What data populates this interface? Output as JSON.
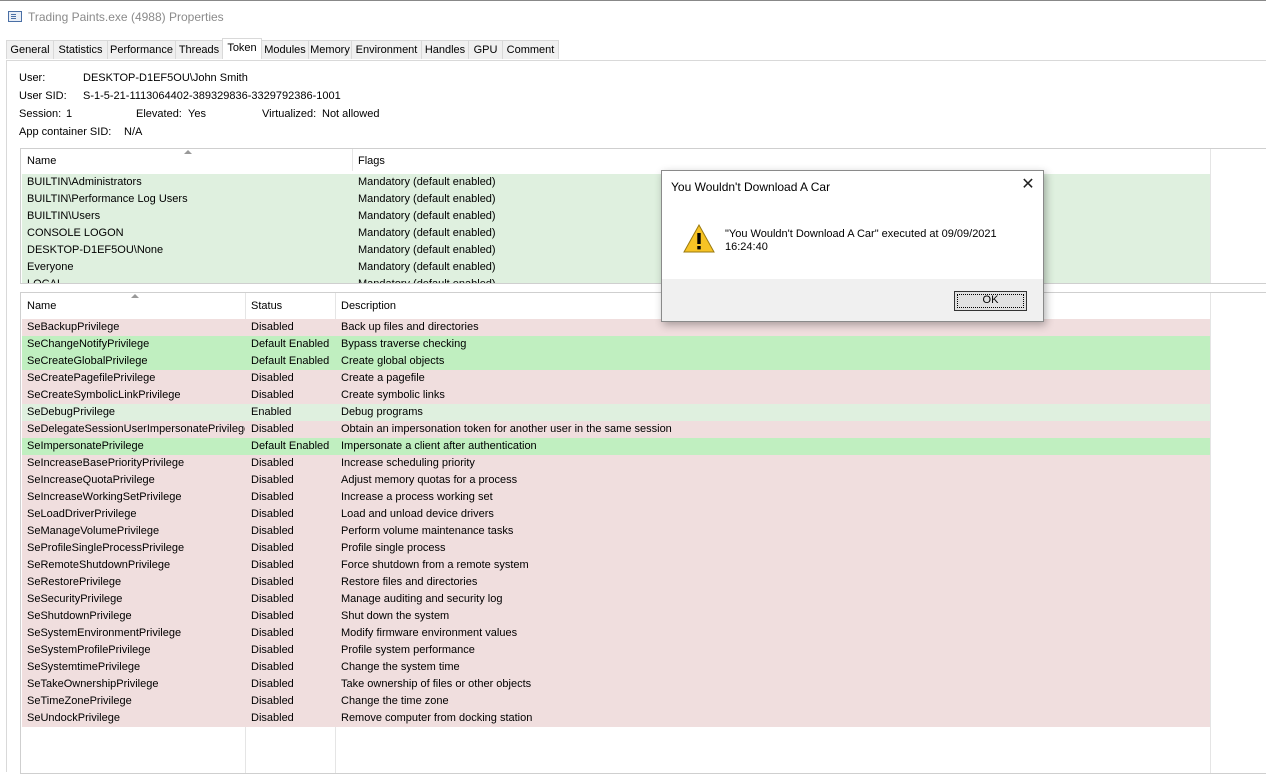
{
  "window": {
    "title": "Trading Paints.exe (4988) Properties",
    "icon": "window-app-icon"
  },
  "tabs": [
    {
      "label": "General"
    },
    {
      "label": "Statistics"
    },
    {
      "label": "Performance"
    },
    {
      "label": "Threads"
    },
    {
      "label": "Token",
      "active": true
    },
    {
      "label": "Modules"
    },
    {
      "label": "Memory"
    },
    {
      "label": "Environment"
    },
    {
      "label": "Handles"
    },
    {
      "label": "GPU"
    },
    {
      "label": "Comment"
    }
  ],
  "token_info": {
    "user_label": "User:",
    "user_value": "DESKTOP-D1EF5OU\\John Smith",
    "sid_label": "User SID:",
    "sid_value": "S-1-5-21-1113064402-389329836-3329792386-1001",
    "session_label": "Session:",
    "session_value": "1",
    "elevated_label": "Elevated:",
    "elevated_value": "Yes",
    "virtualized_label": "Virtualized:",
    "virtualized_value": "Not allowed",
    "appcontainer_label": "App container SID:",
    "appcontainer_value": "N/A"
  },
  "groups": {
    "headers": {
      "name": "Name",
      "flags": "Flags"
    },
    "rows": [
      {
        "name": "BUILTIN\\Administrators",
        "flags": "Mandatory (default enabled)"
      },
      {
        "name": "BUILTIN\\Performance Log Users",
        "flags": "Mandatory (default enabled)"
      },
      {
        "name": "BUILTIN\\Users",
        "flags": "Mandatory (default enabled)"
      },
      {
        "name": "CONSOLE LOGON",
        "flags": "Mandatory (default enabled)"
      },
      {
        "name": "DESKTOP-D1EF5OU\\None",
        "flags": "Mandatory (default enabled)"
      },
      {
        "name": "Everyone",
        "flags": "Mandatory (default enabled)"
      },
      {
        "name": "LOCAL",
        "flags": "Mandatory (default enabled)"
      }
    ],
    "row_color": "#dff0df"
  },
  "privileges": {
    "headers": {
      "name": "Name",
      "status": "Status",
      "description": "Description"
    },
    "colors": {
      "Disabled": "#f0dede",
      "Default Enabled": "#c0efc0",
      "Enabled": "#dff0df"
    },
    "rows": [
      {
        "name": "SeBackupPrivilege",
        "status": "Disabled",
        "description": "Back up files and directories"
      },
      {
        "name": "SeChangeNotifyPrivilege",
        "status": "Default Enabled",
        "description": "Bypass traverse checking"
      },
      {
        "name": "SeCreateGlobalPrivilege",
        "status": "Default Enabled",
        "description": "Create global objects"
      },
      {
        "name": "SeCreatePagefilePrivilege",
        "status": "Disabled",
        "description": "Create a pagefile"
      },
      {
        "name": "SeCreateSymbolicLinkPrivilege",
        "status": "Disabled",
        "description": "Create symbolic links"
      },
      {
        "name": "SeDebugPrivilege",
        "status": "Enabled",
        "description": "Debug programs"
      },
      {
        "name": "SeDelegateSessionUserImpersonatePrivilege",
        "status": "Disabled",
        "description": "Obtain an impersonation token for another user in the same session"
      },
      {
        "name": "SeImpersonatePrivilege",
        "status": "Default Enabled",
        "description": "Impersonate a client after authentication"
      },
      {
        "name": "SeIncreaseBasePriorityPrivilege",
        "status": "Disabled",
        "description": "Increase scheduling priority"
      },
      {
        "name": "SeIncreaseQuotaPrivilege",
        "status": "Disabled",
        "description": "Adjust memory quotas for a process"
      },
      {
        "name": "SeIncreaseWorkingSetPrivilege",
        "status": "Disabled",
        "description": "Increase a process working set"
      },
      {
        "name": "SeLoadDriverPrivilege",
        "status": "Disabled",
        "description": "Load and unload device drivers"
      },
      {
        "name": "SeManageVolumePrivilege",
        "status": "Disabled",
        "description": "Perform volume maintenance tasks"
      },
      {
        "name": "SeProfileSingleProcessPrivilege",
        "status": "Disabled",
        "description": "Profile single process"
      },
      {
        "name": "SeRemoteShutdownPrivilege",
        "status": "Disabled",
        "description": "Force shutdown from a remote system"
      },
      {
        "name": "SeRestorePrivilege",
        "status": "Disabled",
        "description": "Restore files and directories"
      },
      {
        "name": "SeSecurityPrivilege",
        "status": "Disabled",
        "description": "Manage auditing and security log"
      },
      {
        "name": "SeShutdownPrivilege",
        "status": "Disabled",
        "description": "Shut down the system"
      },
      {
        "name": "SeSystemEnvironmentPrivilege",
        "status": "Disabled",
        "description": "Modify firmware environment values"
      },
      {
        "name": "SeSystemProfilePrivilege",
        "status": "Disabled",
        "description": "Profile system performance"
      },
      {
        "name": "SeSystemtimePrivilege",
        "status": "Disabled",
        "description": "Change the system time"
      },
      {
        "name": "SeTakeOwnershipPrivilege",
        "status": "Disabled",
        "description": "Take ownership of files or other objects"
      },
      {
        "name": "SeTimeZonePrivilege",
        "status": "Disabled",
        "description": "Change the time zone"
      },
      {
        "name": "SeUndockPrivilege",
        "status": "Disabled",
        "description": "Remove computer from docking station"
      }
    ]
  },
  "dialog": {
    "title": "You Wouldn't Download A Car",
    "message": "\"You Wouldn't Download A Car\" executed at 09/09/2021 16:24:40",
    "ok_label": "OK",
    "icon": "warning-icon",
    "close_icon": "close-icon"
  }
}
